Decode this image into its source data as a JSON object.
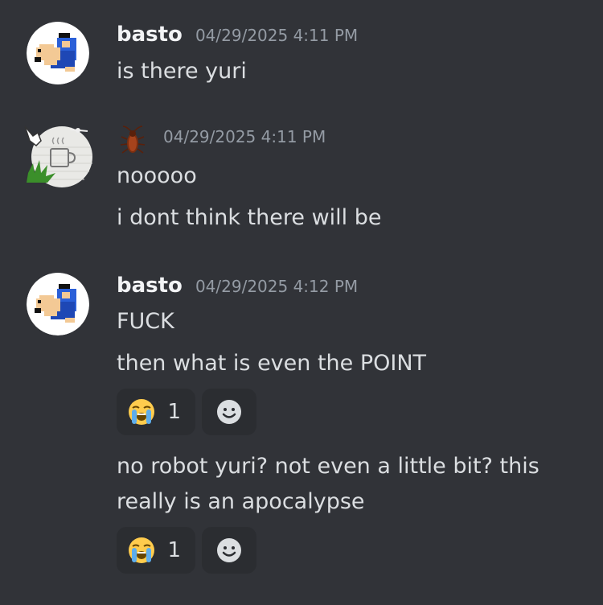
{
  "messages": [
    {
      "author": "basto",
      "timestamp": "04/29/2025 4:11 PM",
      "lines": [
        "is there yuri"
      ]
    },
    {
      "author_icon": "cockroach-icon",
      "timestamp": "04/29/2025 4:11 PM",
      "lines": [
        "nooooo",
        "i dont think there will be"
      ]
    },
    {
      "author": "basto",
      "timestamp": "04/29/2025 4:12 PM",
      "lines": [
        "FUCK",
        "then what is even the POINT"
      ],
      "reaction1": {
        "emoji": "loudly-crying-face",
        "count": "1"
      },
      "followup": "no robot yuri? not even a little bit? this really is an apocalypse",
      "reaction2": {
        "emoji": "loudly-crying-face",
        "count": "1"
      }
    }
  ],
  "colors": {
    "background": "#313338",
    "username": "#f2f3f5",
    "timestamp": "#949ba4",
    "text": "#dbdee1",
    "reaction_bg": "#2b2d31"
  }
}
